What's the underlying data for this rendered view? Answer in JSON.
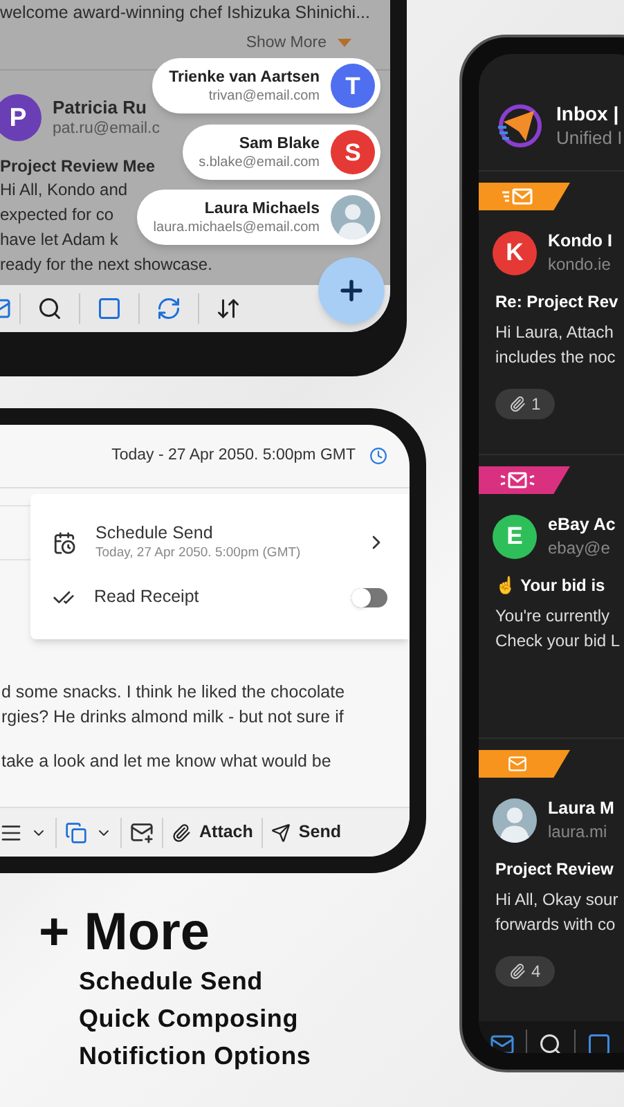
{
  "contacts_screen": {
    "preview_text": "welcome award-winning chef Ishizuka Shinichi...",
    "show_more": "Show More",
    "email": {
      "initial": "P",
      "sender": "Patricia Ru",
      "address": "pat.ru@email.c",
      "subject": "Project Review Mee",
      "body_lines": [
        "Hi All, Kondo and",
        "expected for co",
        "have let Adam k",
        "ready for the next showcase."
      ]
    },
    "suggestions": [
      {
        "kind": "initial",
        "initial": "T",
        "color": "#4f6ef0",
        "name": "Trienke van Aartsen",
        "email": "trivan@email.com"
      },
      {
        "kind": "initial",
        "initial": "S",
        "color": "#e53935",
        "name": "Sam Blake",
        "email": "s.blake@email.com"
      },
      {
        "kind": "photo",
        "name": "Laura Michaels",
        "email": "laura.michaels@email.com"
      }
    ]
  },
  "compose_screen": {
    "schedule_label": "Today - 27 Apr 2050. 5:00pm GMT",
    "options": [
      {
        "kind": "schedule",
        "title": "Schedule Send",
        "subtitle": "Today, 27 Apr 2050. 5:00pm (GMT)"
      },
      {
        "kind": "toggle",
        "title": "Read Receipt",
        "on": false
      }
    ],
    "body_paragraphs": [
      [
        "d some snacks. I think he liked the chocolate",
        "rgies? He drinks almond milk - but not sure if"
      ],
      [
        "take a look and let me know what would be"
      ]
    ],
    "attach": "Attach",
    "send": "Send"
  },
  "inbox_screen": {
    "title": "Inbox |",
    "subtitle": "Unified I",
    "messages": [
      {
        "tag": {
          "kind": "fast",
          "color": "#f7941d"
        },
        "avatar": {
          "kind": "initial",
          "initial": "K",
          "color": "#e53935"
        },
        "sender": "Kondo I",
        "address": "kondo.ie",
        "subject": "Re: Project Rev",
        "preview_lines": [
          "Hi Laura, Attach",
          "includes the noc"
        ],
        "attachments": "1"
      },
      {
        "tag": {
          "kind": "alert",
          "color": "#d9307f"
        },
        "avatar": {
          "kind": "initial",
          "initial": "E",
          "color": "#2fbf5a"
        },
        "sender": "eBay Ac",
        "address": "ebay@e",
        "subject": "☝ Your bid is",
        "preview_lines": [
          "You're currently",
          "Check your bid L"
        ]
      },
      {
        "tag": {
          "kind": "plain",
          "color": "#f7941d"
        },
        "avatar": {
          "kind": "photo"
        },
        "sender": "Laura M",
        "address": "laura.mi",
        "subject": "Project Review",
        "preview_lines": [
          "Hi All, Okay sour",
          "forwards with co"
        ],
        "attachments": "4"
      }
    ]
  },
  "promo": {
    "heading": "+ More",
    "features": [
      "Schedule Send",
      "Quick Composing",
      "Notifiction Options"
    ]
  }
}
